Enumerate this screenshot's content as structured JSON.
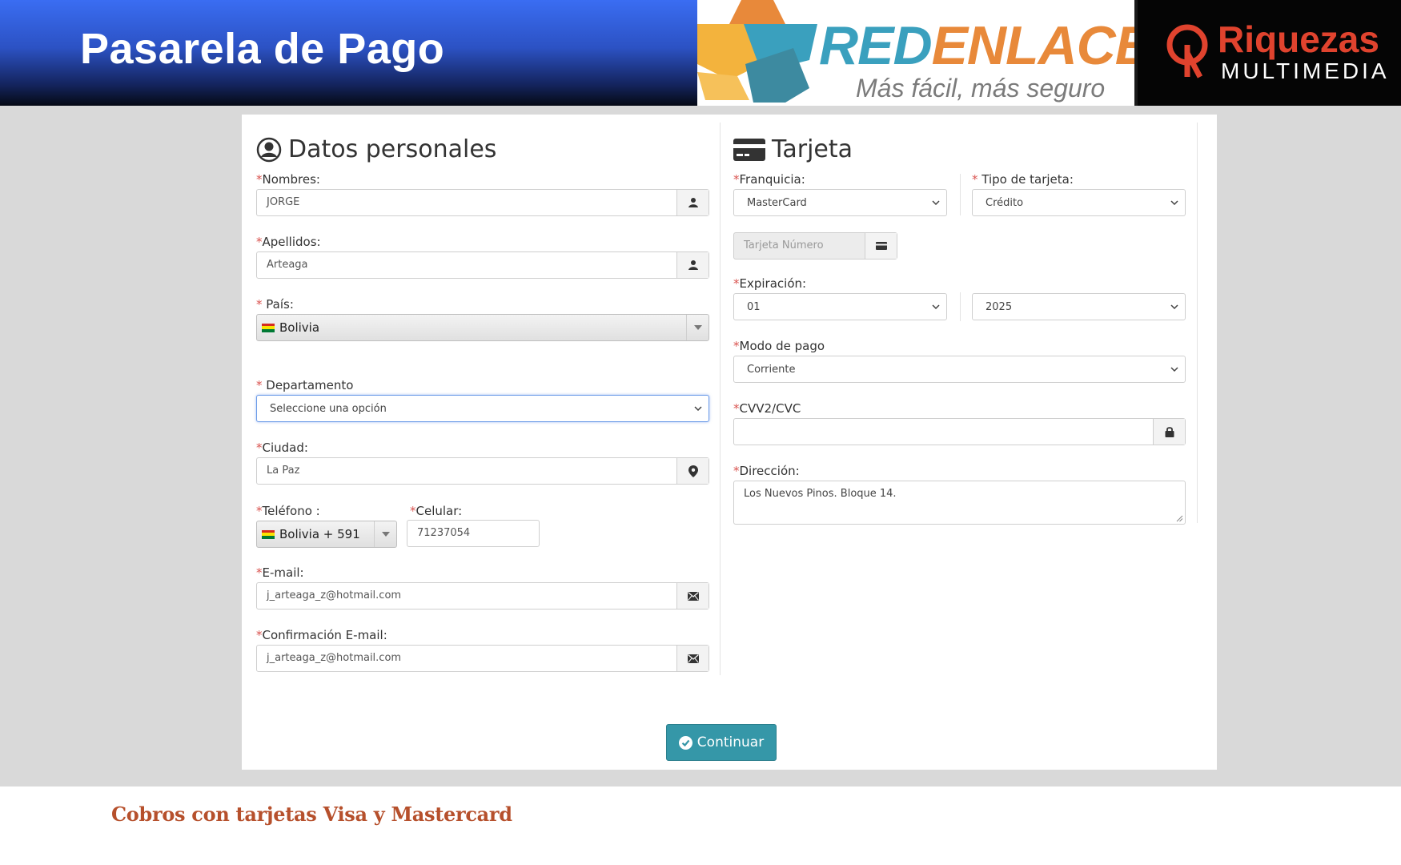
{
  "banner": {
    "title": "Pasarela de Pago",
    "redenlace_red": "RED",
    "redenlace_enlace": "ENLACE",
    "redenlace_slogan": "Más fácil, más seguro",
    "riquezas_word": "Riquezas",
    "riquezas_sub": "MULTIMEDIA"
  },
  "personal": {
    "title": "Datos personales",
    "nombres_label": "Nombres:",
    "nombres_value": "JORGE",
    "apellidos_label": "Apellidos:",
    "apellidos_value": "Arteaga",
    "pais_label": "País:",
    "pais_value": "Bolivia",
    "departamento_label": "Departamento",
    "departamento_value": "Seleccione una opción",
    "ciudad_label": "Ciudad:",
    "ciudad_value": "La Paz",
    "telefono_label": "Teléfono :",
    "telefono_value": "Bolivia + 591",
    "celular_label": "Celular:",
    "celular_value": "71237054",
    "email_label": "E-mail:",
    "email_value": "j_arteaga_z@hotmail.com",
    "email_confirm_label": "Confirmación E-mail:",
    "email_confirm_value": "j_arteaga_z@hotmail.com"
  },
  "card": {
    "title": "Tarjeta",
    "franquicia_label": "Franquicia:",
    "franquicia_value": "MasterCard",
    "tipo_label": "Tipo de tarjeta:",
    "tipo_value": "Crédito",
    "numero_placeholder": "Tarjeta Número",
    "expiracion_label": "Expiración:",
    "mes_value": "01",
    "anio_value": "2025",
    "modo_label": "Modo de pago",
    "modo_value": "Corriente",
    "cvv_label": "CVV2/CVC",
    "cvv_value": "",
    "direccion_label": "Dirección:",
    "direccion_value": "Los Nuevos Pinos. Bloque 14."
  },
  "continue_label": "Continuar",
  "footer": "Cobros con tarjetas Visa y Mastercard",
  "colors": {
    "accent": "#3597a8",
    "required": "#d9534f",
    "footer": "#b6502c",
    "banner_blue": "#3a6df2"
  }
}
